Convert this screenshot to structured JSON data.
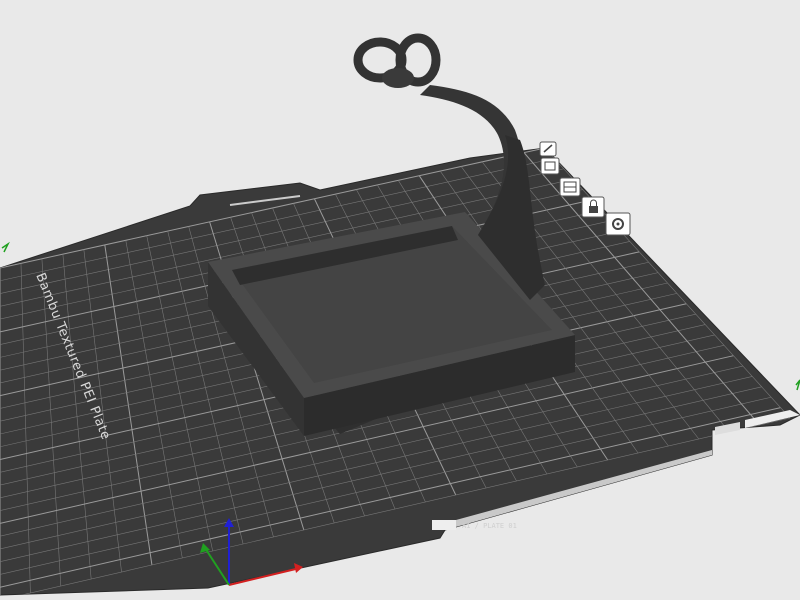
{
  "plate": {
    "name": "Bambu Textured PEI Plate",
    "name_label": "Bambu Textured PEI Plate",
    "footer_text": "A1 / PLATE 01"
  },
  "toolbar": {
    "buttons": [
      {
        "icon": "edit-icon"
      },
      {
        "icon": "auto-orient-icon"
      },
      {
        "icon": "arrange-icon"
      },
      {
        "icon": "lock-icon"
      },
      {
        "icon": "settings-icon"
      }
    ]
  },
  "axes": {
    "x_color": "#d42020",
    "y_color": "#20a020",
    "z_color": "#2020d4"
  },
  "colors": {
    "background": "#e9e9e9",
    "plate": "#3a3a3a",
    "grid": "#8a8a8a",
    "model": "#3f3f3f"
  }
}
